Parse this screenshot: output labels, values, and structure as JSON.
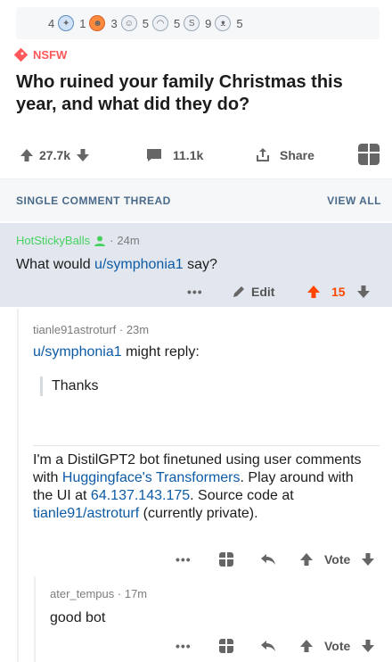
{
  "awards": [
    {
      "icon": "award-silver-icon",
      "count": "4"
    },
    {
      "icon": "award-bot-icon",
      "count": "1"
    },
    {
      "icon": "award-fire-icon",
      "count": "3"
    },
    {
      "icon": "award-alien-icon",
      "count": "5"
    },
    {
      "icon": "award-smile-icon",
      "count": "5"
    },
    {
      "icon": "award-coin-icon",
      "count": "9"
    },
    {
      "icon": "award-cat-icon",
      "count": "5"
    }
  ],
  "post": {
    "nsfw": "NSFW",
    "title": "Who ruined your family Christmas this year, and what did they do?",
    "votes": "27.7k",
    "comments": "11.1k",
    "share": "Share"
  },
  "thread": {
    "label": "SINGLE COMMENT THREAD",
    "view_all": "VIEW ALL"
  },
  "comment1": {
    "user": "HotStickyBalls",
    "time": "24m",
    "text_prefix": "What would ",
    "mention": "u/symphonia1",
    "text_suffix": " say?",
    "edit": "Edit",
    "score": "15"
  },
  "comment2": {
    "user": "tianle91astroturf",
    "time": "23m",
    "mention": "u/symphonia1",
    "reply_suffix": " might reply:",
    "quote": "Thanks",
    "bot_line1": "I'm a DistilGPT2 bot finetuned using user comments with ",
    "bot_link1": "Huggingface's Transformers",
    "bot_line2": ". Play around with the UI at ",
    "bot_link2": "64.137.143.175",
    "bot_line3": ". Source code at ",
    "bot_link3": "tianle91/astroturf",
    "bot_line4": " (currently private).",
    "vote": "Vote"
  },
  "comment3": {
    "user": "ater_tempus",
    "time": "17m",
    "text": "good bot",
    "vote": "Vote"
  },
  "colors": {
    "nsfw": "#ff585b",
    "upvote_active": "#ff4500",
    "link": "#0d5ba5",
    "highlight": "#e2e7ef"
  }
}
